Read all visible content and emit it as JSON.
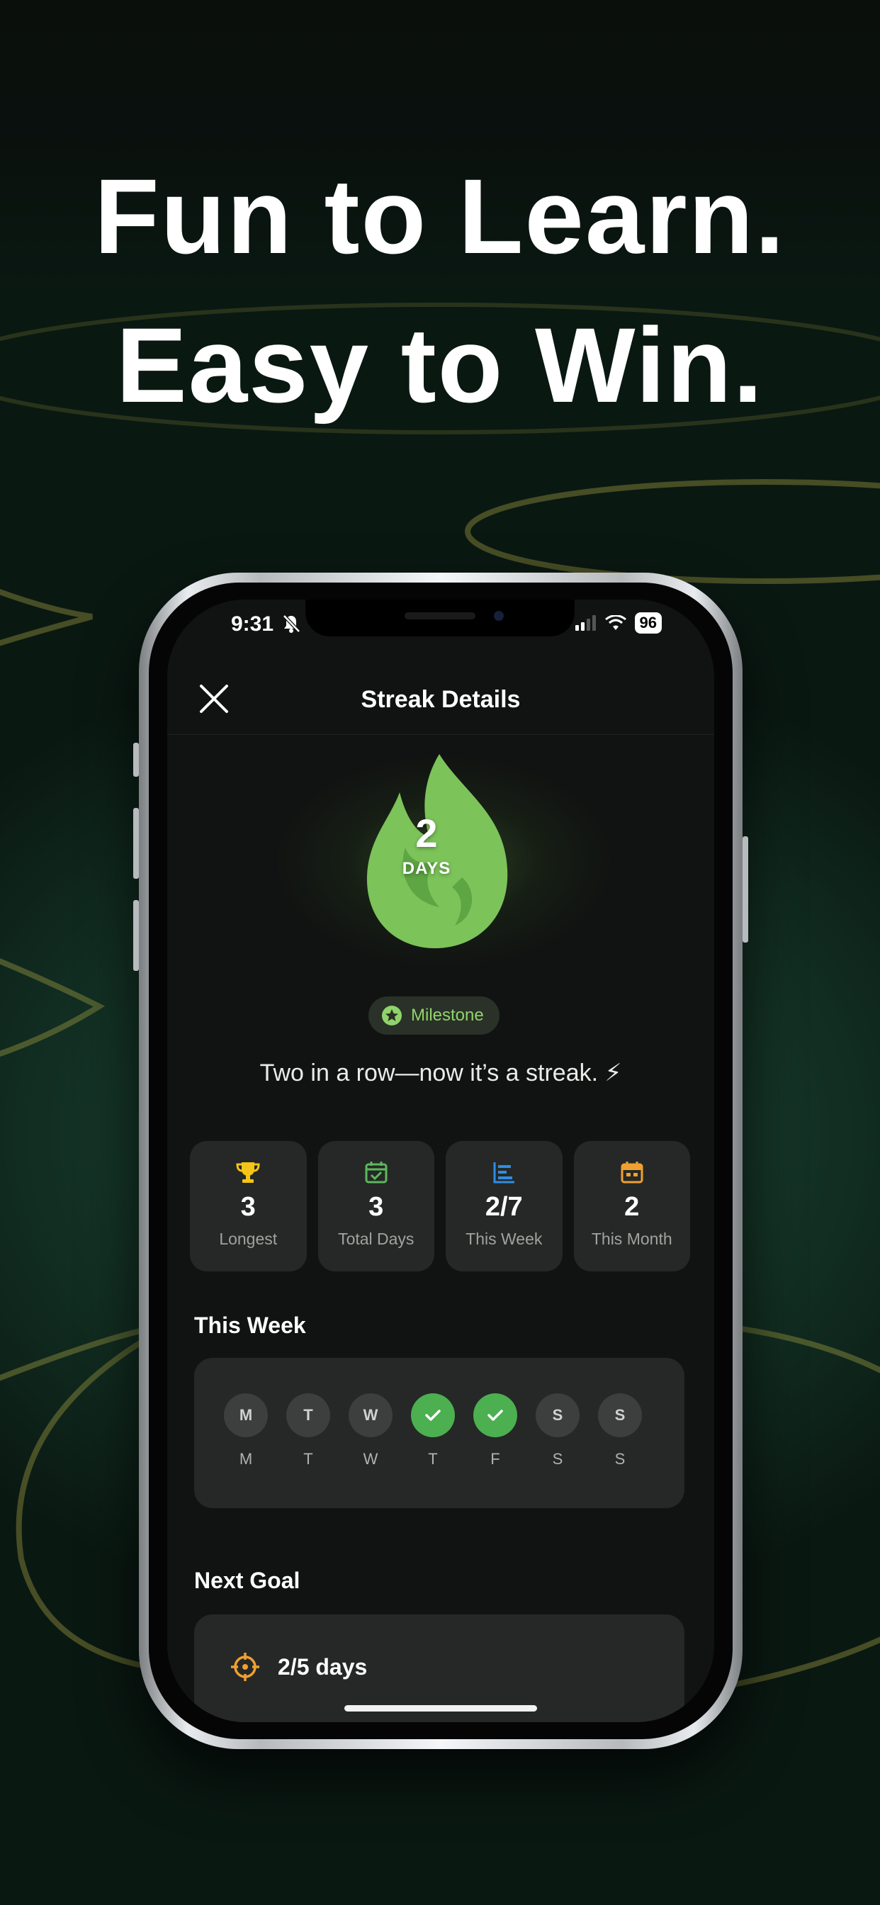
{
  "headline": {
    "line1": "Fun to Learn.",
    "line2": "Easy to Win."
  },
  "status_bar": {
    "time": "9:31",
    "battery": "96"
  },
  "header": {
    "title": "Streak Details"
  },
  "streak": {
    "count": "2",
    "unit": "DAYS",
    "flame_color": "#7cc35a"
  },
  "milestone": {
    "label": "Milestone"
  },
  "tagline": "Two in a row—now it’s a streak. ⚡",
  "stats": [
    {
      "icon": "trophy-icon",
      "value": "3",
      "label": "Longest",
      "color": "#f5c518"
    },
    {
      "icon": "calendar-check-icon",
      "value": "3",
      "label": "Total Days",
      "color": "#5cb85c"
    },
    {
      "icon": "chart-icon",
      "value": "2/7",
      "label": "This Week",
      "color": "#2f8de4"
    },
    {
      "icon": "calendar-icon",
      "value": "2",
      "label": "This Month",
      "color": "#f0a030"
    }
  ],
  "this_week": {
    "title": "This Week",
    "days": [
      {
        "circle": "M",
        "label": "M",
        "done": false
      },
      {
        "circle": "T",
        "label": "T",
        "done": false
      },
      {
        "circle": "W",
        "label": "W",
        "done": false
      },
      {
        "circle": "",
        "label": "T",
        "done": true
      },
      {
        "circle": "",
        "label": "F",
        "done": true
      },
      {
        "circle": "S",
        "label": "S",
        "done": false
      },
      {
        "circle": "S",
        "label": "S",
        "done": false
      }
    ]
  },
  "next_goal": {
    "title": "Next Goal",
    "progress": "2/5 days",
    "accent": "#f0a030"
  }
}
